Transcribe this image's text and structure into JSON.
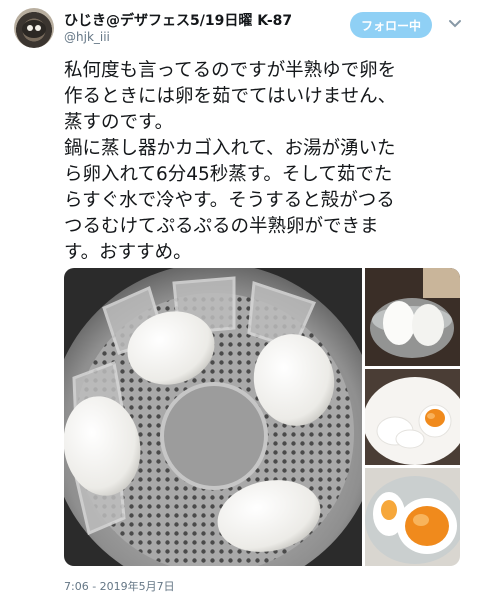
{
  "user": {
    "display_name": "ひじき@デザフェス5/19日曜 K-87",
    "handle": "@hjk_iii"
  },
  "follow_button": {
    "label": "フォロー中"
  },
  "tweet": {
    "text": "私何度も言ってるのですが半熟ゆで卵を\n作るときには卵を茹でてはいけません、\n蒸すのです。\n鍋に蒸し器かカゴ入れて、お湯が湧いた\nら卵入れて6分45秒蒸す。そして茹でた\nらすぐ水で冷やす。そうすると殻がつる\nつるむけてぷるぷるの半熟卵ができま\nす。おすすめ。",
    "timestamp": "7:06 - 2019年5月7日"
  },
  "media": [
    {
      "name": "photo-eggs-in-steamer"
    },
    {
      "name": "photo-peeled-eggs-in-glass-bowl"
    },
    {
      "name": "photo-halved-eggs-on-plate"
    },
    {
      "name": "photo-soft-boiled-egg-yolk-closeup"
    }
  ],
  "icons": {
    "avatar": "raccoon-dog-avatar-icon",
    "more": "chevron-down-icon"
  },
  "colors": {
    "follow_button_bg": "#8fd0f5",
    "secondary_text": "#657786",
    "yolk": "#f08a1c"
  }
}
